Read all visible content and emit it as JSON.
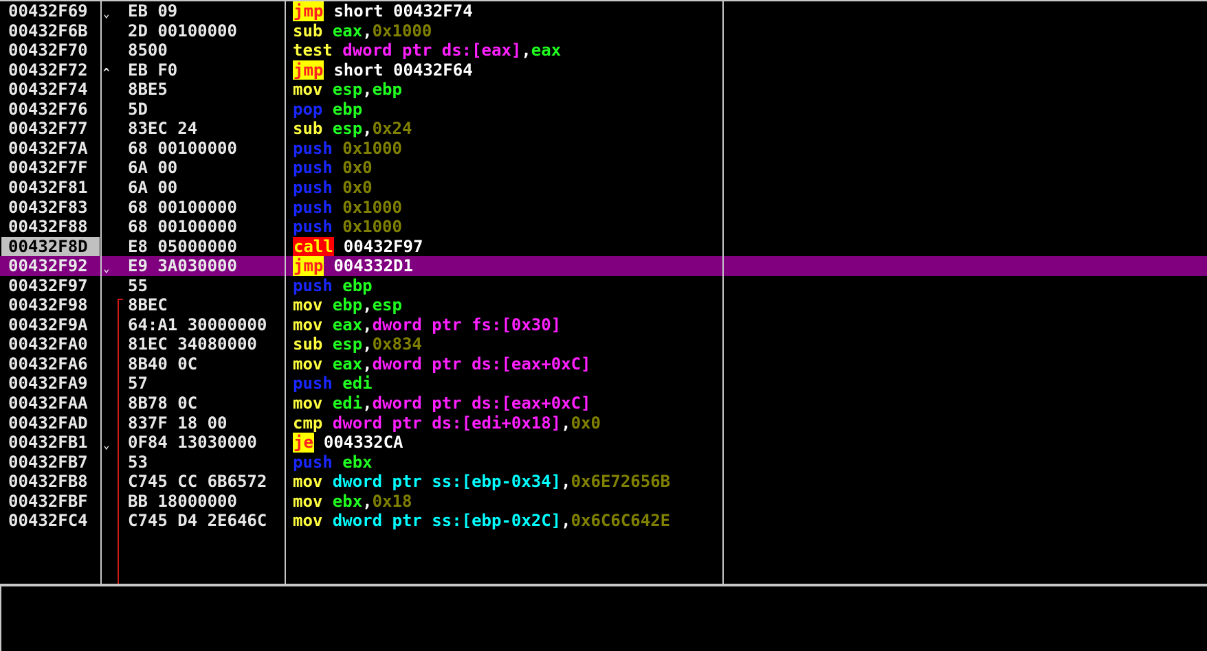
{
  "colors": {
    "background": "#000000",
    "selected_row": "#800080",
    "eip_address_bg": "#c0c0c0",
    "jmp_bg": "#ffff00",
    "jmp_fg": "#ff2020",
    "call_bg": "#ff0000",
    "call_fg": "#ffff00",
    "push_pop": "#1a28ff",
    "mov_sub_test_cmp": "#ffff40",
    "register": "#20ff20",
    "immediate": "#808000",
    "memory_ds_fs": "#ff20ff",
    "memory_ss": "#00ffff",
    "target": "#ffffff"
  },
  "rows": [
    {
      "addr": "00432F69",
      "mark": "⌄",
      "hex": "EB 09",
      "ins": [
        [
          "jmp",
          "jmp"
        ],
        [
          "short 00432F74",
          "tgt"
        ]
      ]
    },
    {
      "addr": "00432F6B",
      "mark": "",
      "hex": "2D 00100000",
      "ins": [
        [
          "sub ",
          "mn"
        ],
        [
          "eax",
          "reg"
        ],
        [
          ",",
          "pn"
        ],
        [
          "0x1000",
          "imm"
        ]
      ]
    },
    {
      "addr": "00432F70",
      "mark": "",
      "hex": "8500",
      "ins": [
        [
          "test ",
          "mn"
        ],
        [
          "dword ptr ds:[eax]",
          "mem"
        ],
        [
          ",",
          "pn"
        ],
        [
          "eax",
          "reg"
        ]
      ]
    },
    {
      "addr": "00432F72",
      "mark": "^",
      "hex": "EB F0",
      "ins": [
        [
          "jmp",
          "jmp"
        ],
        [
          "short 00432F64",
          "tgt"
        ]
      ]
    },
    {
      "addr": "00432F74",
      "mark": "",
      "hex": "8BE5",
      "ins": [
        [
          "mov ",
          "mn"
        ],
        [
          "esp",
          "reg"
        ],
        [
          ",",
          "pn"
        ],
        [
          "ebp",
          "reg"
        ]
      ]
    },
    {
      "addr": "00432F76",
      "mark": "",
      "hex": "5D",
      "ins": [
        [
          "pop ",
          "pp"
        ],
        [
          "ebp",
          "reg"
        ]
      ]
    },
    {
      "addr": "00432F77",
      "mark": "",
      "hex": "83EC 24",
      "ins": [
        [
          "sub ",
          "mn"
        ],
        [
          "esp",
          "reg"
        ],
        [
          ",",
          "pn"
        ],
        [
          "0x24",
          "imm"
        ]
      ]
    },
    {
      "addr": "00432F7A",
      "mark": "",
      "hex": "68 00100000",
      "ins": [
        [
          "push ",
          "pp"
        ],
        [
          "0x1000",
          "imm"
        ]
      ]
    },
    {
      "addr": "00432F7F",
      "mark": "",
      "hex": "6A 00",
      "ins": [
        [
          "push ",
          "pp"
        ],
        [
          "0x0",
          "imm"
        ]
      ]
    },
    {
      "addr": "00432F81",
      "mark": "",
      "hex": "6A 00",
      "ins": [
        [
          "push ",
          "pp"
        ],
        [
          "0x0",
          "imm"
        ]
      ]
    },
    {
      "addr": "00432F83",
      "mark": "",
      "hex": "68 00100000",
      "ins": [
        [
          "push ",
          "pp"
        ],
        [
          "0x1000",
          "imm"
        ]
      ]
    },
    {
      "addr": "00432F88",
      "mark": "",
      "hex": "68 00100000",
      "ins": [
        [
          "push ",
          "pp"
        ],
        [
          "0x1000",
          "imm"
        ]
      ]
    },
    {
      "addr": "00432F8D",
      "mark": "",
      "hex": "E8 05000000",
      "eip": true,
      "ins": [
        [
          "call",
          "call"
        ],
        [
          "00432F97",
          "tgt"
        ]
      ]
    },
    {
      "addr": "00432F92",
      "mark": "⌄",
      "hex": "E9 3A030000",
      "selected": true,
      "ins": [
        [
          "jmp",
          "jmp"
        ],
        [
          "004332D1",
          "tgt"
        ]
      ]
    },
    {
      "addr": "00432F97",
      "mark": "",
      "hex": "55",
      "ins": [
        [
          "push ",
          "pp"
        ],
        [
          "ebp",
          "reg"
        ]
      ]
    },
    {
      "addr": "00432F98",
      "mark": "",
      "hex": "8BEC",
      "ins": [
        [
          "mov ",
          "mn"
        ],
        [
          "ebp",
          "reg"
        ],
        [
          ",",
          "pn"
        ],
        [
          "esp",
          "reg"
        ]
      ]
    },
    {
      "addr": "00432F9A",
      "mark": "",
      "hex": "64:A1 30000000",
      "ins": [
        [
          "mov ",
          "mn"
        ],
        [
          "eax",
          "reg"
        ],
        [
          ",",
          "pn"
        ],
        [
          "dword ptr fs:[0x30]",
          "mem"
        ]
      ]
    },
    {
      "addr": "00432FA0",
      "mark": "",
      "hex": "81EC 34080000",
      "ins": [
        [
          "sub ",
          "mn"
        ],
        [
          "esp",
          "reg"
        ],
        [
          ",",
          "pn"
        ],
        [
          "0x834",
          "imm"
        ]
      ]
    },
    {
      "addr": "00432FA6",
      "mark": "",
      "hex": "8B40 0C",
      "ins": [
        [
          "mov ",
          "mn"
        ],
        [
          "eax",
          "reg"
        ],
        [
          ",",
          "pn"
        ],
        [
          "dword ptr ds:[eax+0xC]",
          "mem"
        ]
      ]
    },
    {
      "addr": "00432FA9",
      "mark": "",
      "hex": "57",
      "ins": [
        [
          "push ",
          "pp"
        ],
        [
          "edi",
          "reg"
        ]
      ]
    },
    {
      "addr": "00432FAA",
      "mark": "",
      "hex": "8B78 0C",
      "ins": [
        [
          "mov ",
          "mn"
        ],
        [
          "edi",
          "reg"
        ],
        [
          ",",
          "pn"
        ],
        [
          "dword ptr ds:[eax+0xC]",
          "mem"
        ]
      ]
    },
    {
      "addr": "00432FAD",
      "mark": "",
      "hex": "837F 18 00",
      "ins": [
        [
          "cmp ",
          "mn"
        ],
        [
          "dword ptr ds:[edi+0x18]",
          "mem"
        ],
        [
          ",",
          "pn"
        ],
        [
          "0x0",
          "imm"
        ]
      ]
    },
    {
      "addr": "00432FB1",
      "mark": "⌄",
      "hex": "0F84 13030000",
      "ins": [
        [
          "je",
          "jmp"
        ],
        [
          "004332CA",
          "tgt"
        ]
      ]
    },
    {
      "addr": "00432FB7",
      "mark": "",
      "hex": "53",
      "ins": [
        [
          "push ",
          "pp"
        ],
        [
          "ebx",
          "reg"
        ]
      ]
    },
    {
      "addr": "00432FB8",
      "mark": "",
      "hex": "C745 CC 6B6572",
      "ins": [
        [
          "mov ",
          "mn"
        ],
        [
          "dword ptr ss:[ebp-0x34]",
          "mems"
        ],
        [
          ",",
          "pn"
        ],
        [
          "0x6E72656B",
          "imm"
        ]
      ]
    },
    {
      "addr": "00432FBF",
      "mark": "",
      "hex": "BB 18000000",
      "ins": [
        [
          "mov ",
          "mn"
        ],
        [
          "ebx",
          "reg"
        ],
        [
          ",",
          "pn"
        ],
        [
          "0x18",
          "imm"
        ]
      ]
    },
    {
      "addr": "00432FC4",
      "mark": "",
      "hex": "C745 D4 2E646C",
      "ins": [
        [
          "mov ",
          "mn"
        ],
        [
          "dword ptr ss:[ebp-0x2C]",
          "mems"
        ],
        [
          ",",
          "pn"
        ],
        [
          "0x6C6C642E",
          "imm"
        ]
      ]
    }
  ]
}
